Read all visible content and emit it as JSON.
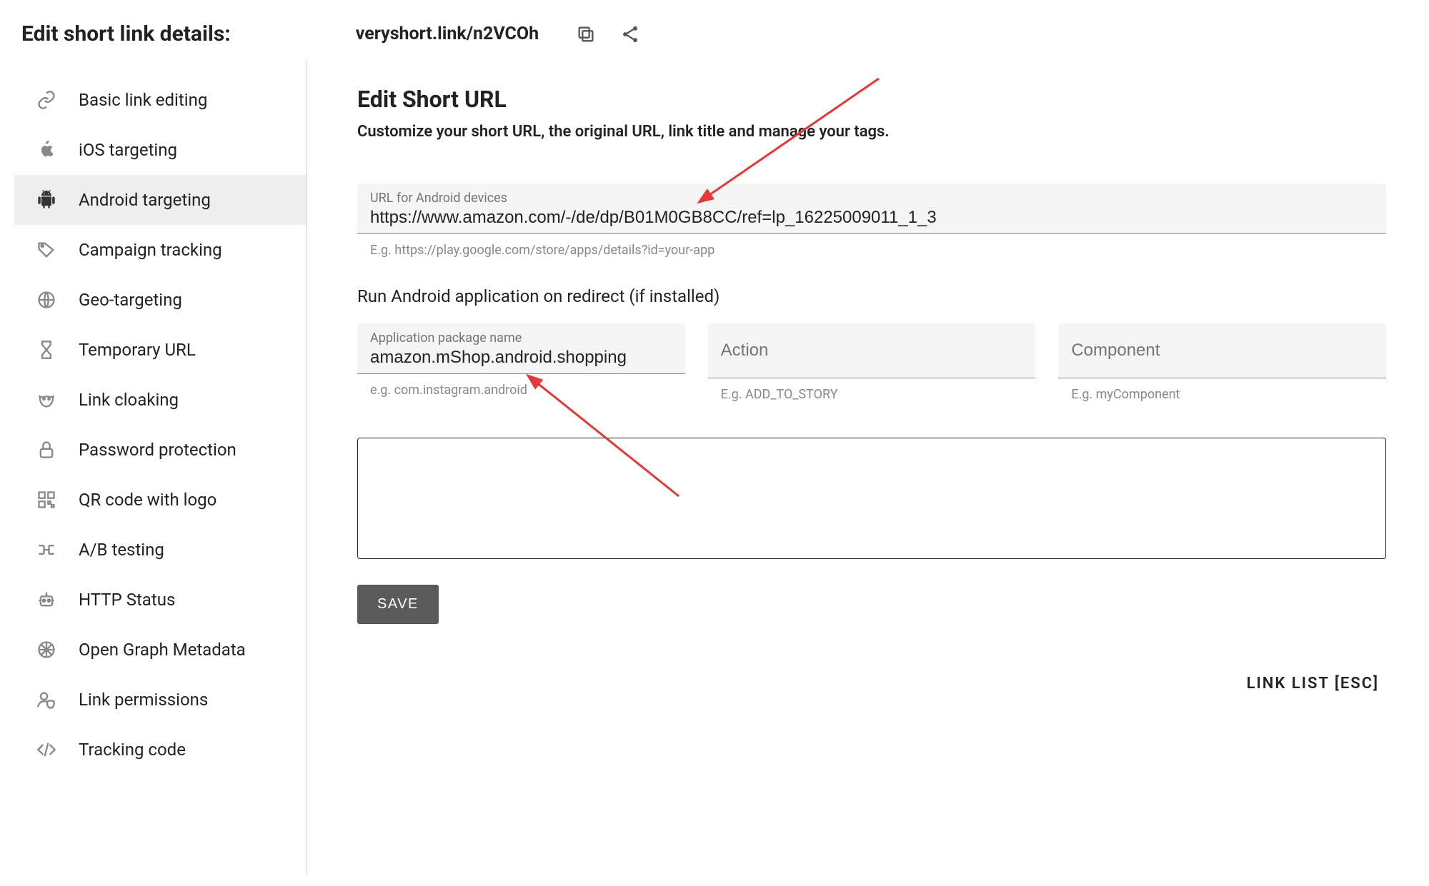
{
  "header": {
    "title": "Edit short link details:",
    "short_link": "veryshort.link/n2VCOh"
  },
  "sidebar": {
    "items": [
      {
        "label": "Basic link editing",
        "icon": "link-icon"
      },
      {
        "label": "iOS targeting",
        "icon": "apple-icon"
      },
      {
        "label": "Android targeting",
        "icon": "android-icon",
        "active": true
      },
      {
        "label": "Campaign tracking",
        "icon": "tag-icon"
      },
      {
        "label": "Geo-targeting",
        "icon": "globe-icon"
      },
      {
        "label": "Temporary URL",
        "icon": "hourglass-icon"
      },
      {
        "label": "Link cloaking",
        "icon": "mask-icon"
      },
      {
        "label": "Password protection",
        "icon": "lock-icon"
      },
      {
        "label": "QR code with logo",
        "icon": "qr-icon"
      },
      {
        "label": "A/B testing",
        "icon": "split-icon"
      },
      {
        "label": "HTTP Status",
        "icon": "robot-icon"
      },
      {
        "label": "Open Graph Metadata",
        "icon": "web-icon"
      },
      {
        "label": "Link permissions",
        "icon": "user-shield-icon"
      },
      {
        "label": "Tracking code",
        "icon": "code-icon"
      }
    ]
  },
  "main": {
    "heading": "Edit Short URL",
    "subtitle": "Customize your short URL, the original URL, link title and manage your tags.",
    "url_field": {
      "label": "URL for Android devices",
      "value": "https://www.amazon.com/-/de/dp/B01M0GB8CC/ref=lp_16225009011_1_3",
      "hint": "E.g. https://play.google.com/store/apps/details?id=your-app"
    },
    "run_heading": "Run Android application on redirect (if installed)",
    "package_field": {
      "label": "Application package name",
      "value": "amazon.mShop.android.shopping",
      "hint": "e.g. com.instagram.android"
    },
    "action_field": {
      "placeholder": "Action",
      "hint": "E.g. ADD_TO_STORY"
    },
    "component_field": {
      "placeholder": "Component",
      "hint": "E.g. myComponent"
    },
    "save_label": "SAVE",
    "link_list_label": "LINK LIST [ESC]"
  }
}
